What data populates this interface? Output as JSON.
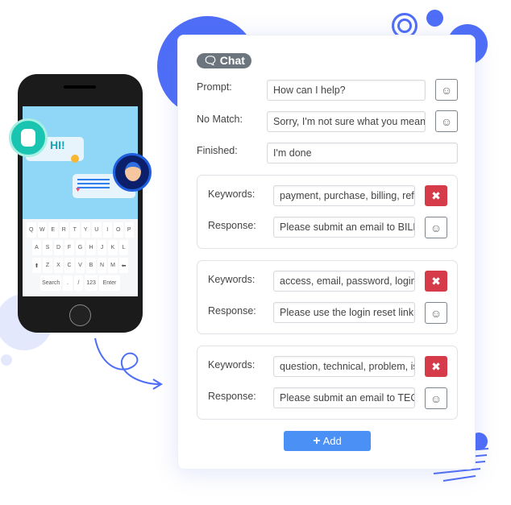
{
  "chat": {
    "badge": "Chat",
    "prompt_label": "Prompt:",
    "prompt_value": "How can I help?",
    "nomatch_label": "No Match:",
    "nomatch_value": "Sorry, I'm not sure what you mean",
    "finished_label": "Finished:",
    "finished_value": "I'm done",
    "groups": [
      {
        "keywords_label": "Keywords:",
        "keywords": "payment, purchase, billing, refund",
        "response_label": "Response:",
        "response": "Please submit an email to BILLING"
      },
      {
        "keywords_label": "Keywords:",
        "keywords": "access, email, password, login",
        "response_label": "Response:",
        "response": "Please use the login reset link"
      },
      {
        "keywords_label": "Keywords:",
        "keywords": "question, technical, problem, issue",
        "response_label": "Response:",
        "response": "Please submit an email to TECH"
      }
    ],
    "add_label": "Add",
    "emoji_icon": "☺",
    "delete_icon": "✖"
  },
  "phone": {
    "greeting": "HI!",
    "keys": [
      [
        "Q",
        "W",
        "E",
        "R",
        "T",
        "Y",
        "U",
        "I",
        "O",
        "P"
      ],
      [
        "A",
        "S",
        "D",
        "F",
        "G",
        "H",
        "J",
        "K",
        "L"
      ],
      [
        "⬆",
        "Z",
        "X",
        "C",
        "V",
        "B",
        "N",
        "M",
        "⬅"
      ],
      [
        "Search",
        ".",
        "/",
        "123",
        "Enter"
      ]
    ]
  },
  "colors": {
    "accent": "#4a90f5",
    "danger": "#d63b4a",
    "decor": "#4f6ef7",
    "badge": "#6c757d"
  }
}
